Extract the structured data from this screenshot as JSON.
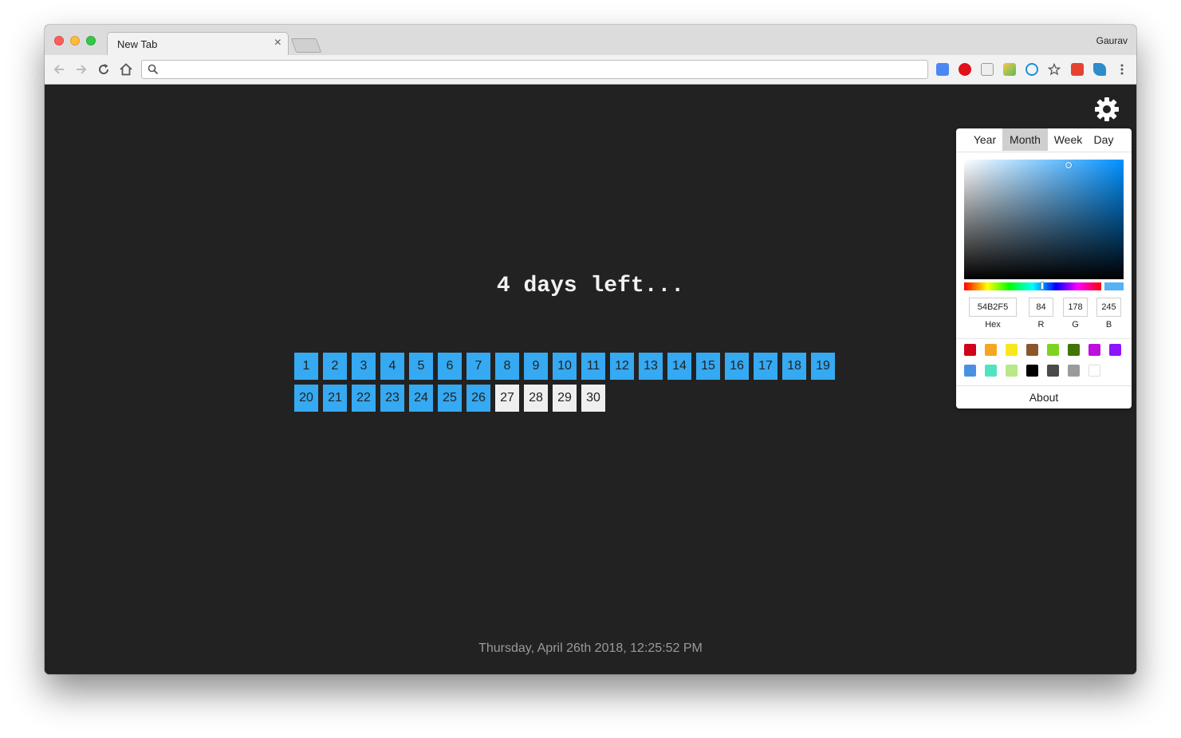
{
  "browser": {
    "tab_title": "New Tab",
    "tab_close_glyph": "×",
    "profile_name": "Gaurav",
    "omnibox_value": "",
    "omnibox_placeholder": "",
    "extensions": [
      "google-translate-icon",
      "adblock-plus-icon",
      "js-toggle-icon",
      "color-picker-ext-icon",
      "onepassword-icon",
      "bookmark-star-icon",
      "todoist-icon",
      "bird-ext-icon",
      "chrome-menu-icon"
    ]
  },
  "main": {
    "heading": "4 days left...",
    "days": [
      "1",
      "2",
      "3",
      "4",
      "5",
      "6",
      "7",
      "8",
      "9",
      "10",
      "11",
      "12",
      "13",
      "14",
      "15",
      "16",
      "17",
      "18",
      "19",
      "20",
      "21",
      "22",
      "23",
      "24",
      "25",
      "26",
      "27",
      "28",
      "29",
      "30"
    ],
    "elapsed_days": 26,
    "clock": "Thursday, April 26th 2018, 12:25:52 PM"
  },
  "settings": {
    "tabs": [
      {
        "label": "Year",
        "active": false
      },
      {
        "label": "Month",
        "active": true
      },
      {
        "label": "Week",
        "active": false
      },
      {
        "label": "Day",
        "active": false
      }
    ],
    "color": {
      "hex": "54B2F5",
      "r": "84",
      "g": "178",
      "b": "245",
      "hex_label": "Hex",
      "r_label": "R",
      "g_label": "G",
      "b_label": "B"
    },
    "presets_row1": [
      "#d0021b",
      "#f5a623",
      "#f8e71c",
      "#8b572a",
      "#7ed321",
      "#417505",
      "#bd10e0",
      "#9013fe"
    ],
    "presets_row2": [
      "#4a90e2",
      "#50e3c2",
      "#b8e986",
      "#000000",
      "#4a4a4a",
      "#9b9b9b",
      "#ffffff"
    ],
    "about_label": "About"
  },
  "colors": {
    "elapsed": "#35a9f2",
    "remaining": "#efefef",
    "background": "#222222"
  }
}
